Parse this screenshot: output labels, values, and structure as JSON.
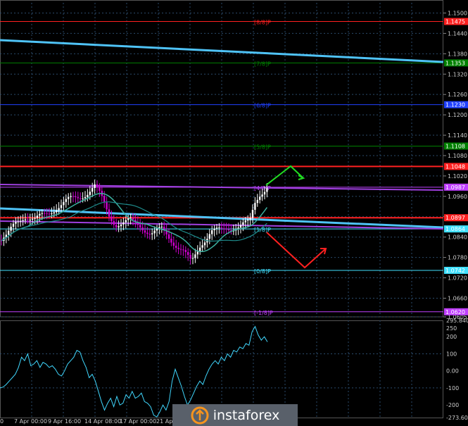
{
  "chart_data": [
    {
      "type": "candlestick",
      "title": "",
      "colors": {
        "background": "#000000",
        "bull": "#ffffff",
        "bear": "#d000d0",
        "grid": "#2a4a6a",
        "axis_text": "#cccccc"
      },
      "y_ticks": [
        "1.1500",
        "1.1440",
        "1.1380",
        "1.1320",
        "1.1260",
        "1.1200",
        "1.1140",
        "1.1080",
        "1.1020",
        "1.0960",
        "1.0900",
        "1.0840",
        "1.0780",
        "1.0720",
        "1.0660",
        "1.0605"
      ],
      "x_ticks": [
        "7 Apr 00:00",
        "9 Apr 16:00",
        "14 Apr 08:00",
        "17 Apr 00:00",
        "21 Apr"
      ],
      "ylim": [
        1.0605,
        1.153
      ],
      "murrey_levels": [
        {
          "label": "[8/8]P",
          "price_tag": "1.1475",
          "value": 1.1475,
          "color": "#ff2020"
        },
        {
          "label": "[7/8]P",
          "price_tag": "1.1353",
          "value": 1.1353,
          "color": "#008000"
        },
        {
          "label": "[6/8]P",
          "price_tag": "1.1230",
          "value": 1.123,
          "color": "#2040ff"
        },
        {
          "label": "[5/8]P",
          "price_tag": "1.1108",
          "value": 1.1108,
          "color": "#008000"
        },
        {
          "label": "",
          "price_tag": "1.1048",
          "value": 1.1048,
          "color": "#ff2020"
        },
        {
          "label": "[4/8]P",
          "price_tag": "1.0987",
          "value": 1.0987,
          "color": "#c040ff"
        },
        {
          "label": "",
          "price_tag": "1.0897",
          "value": 1.0897,
          "color": "#ff2020"
        },
        {
          "label": "[1/8]P",
          "price_tag": "1.0864",
          "value": 1.0864,
          "color": "#40e0ff"
        },
        {
          "label": "[0/8]P",
          "price_tag": "1.0742",
          "value": 1.0742,
          "color": "#40e0ff"
        },
        {
          "label": "[-1/8]P",
          "price_tag": "1.0620",
          "value": 1.062,
          "color": "#c040ff"
        }
      ],
      "price_close": 1.0995,
      "cci": {
        "y_ticks": [
          "295.8402",
          "250",
          "200",
          "100",
          "0.00",
          "-100",
          "-200",
          "-273.604"
        ],
        "ylim": [
          -273.604,
          295.8402
        ],
        "values": [
          -100,
          -95,
          -80,
          -60,
          -40,
          -20,
          20,
          80,
          60,
          100,
          30,
          40,
          60,
          20,
          50,
          40,
          20,
          30,
          10,
          -20,
          -30,
          0,
          40,
          60,
          80,
          120,
          110,
          60,
          20,
          -40,
          -20,
          -60,
          -120,
          -180,
          -230,
          -190,
          -160,
          -210,
          -150,
          -200,
          -190,
          -140,
          -160,
          -120,
          -160,
          -150,
          -130,
          -180,
          -190,
          -210,
          -260,
          -270,
          -240,
          -200,
          -230,
          -180,
          -60,
          10,
          -40,
          -90,
          -150,
          -200,
          -170,
          -130,
          -90,
          -60,
          -80,
          -30,
          10,
          40,
          60,
          40,
          80,
          60,
          100,
          80,
          120,
          110,
          140,
          130,
          160,
          150,
          230,
          260,
          210,
          180,
          200,
          170
        ]
      }
    }
  ],
  "watermark": {
    "brand": "instaforex"
  }
}
